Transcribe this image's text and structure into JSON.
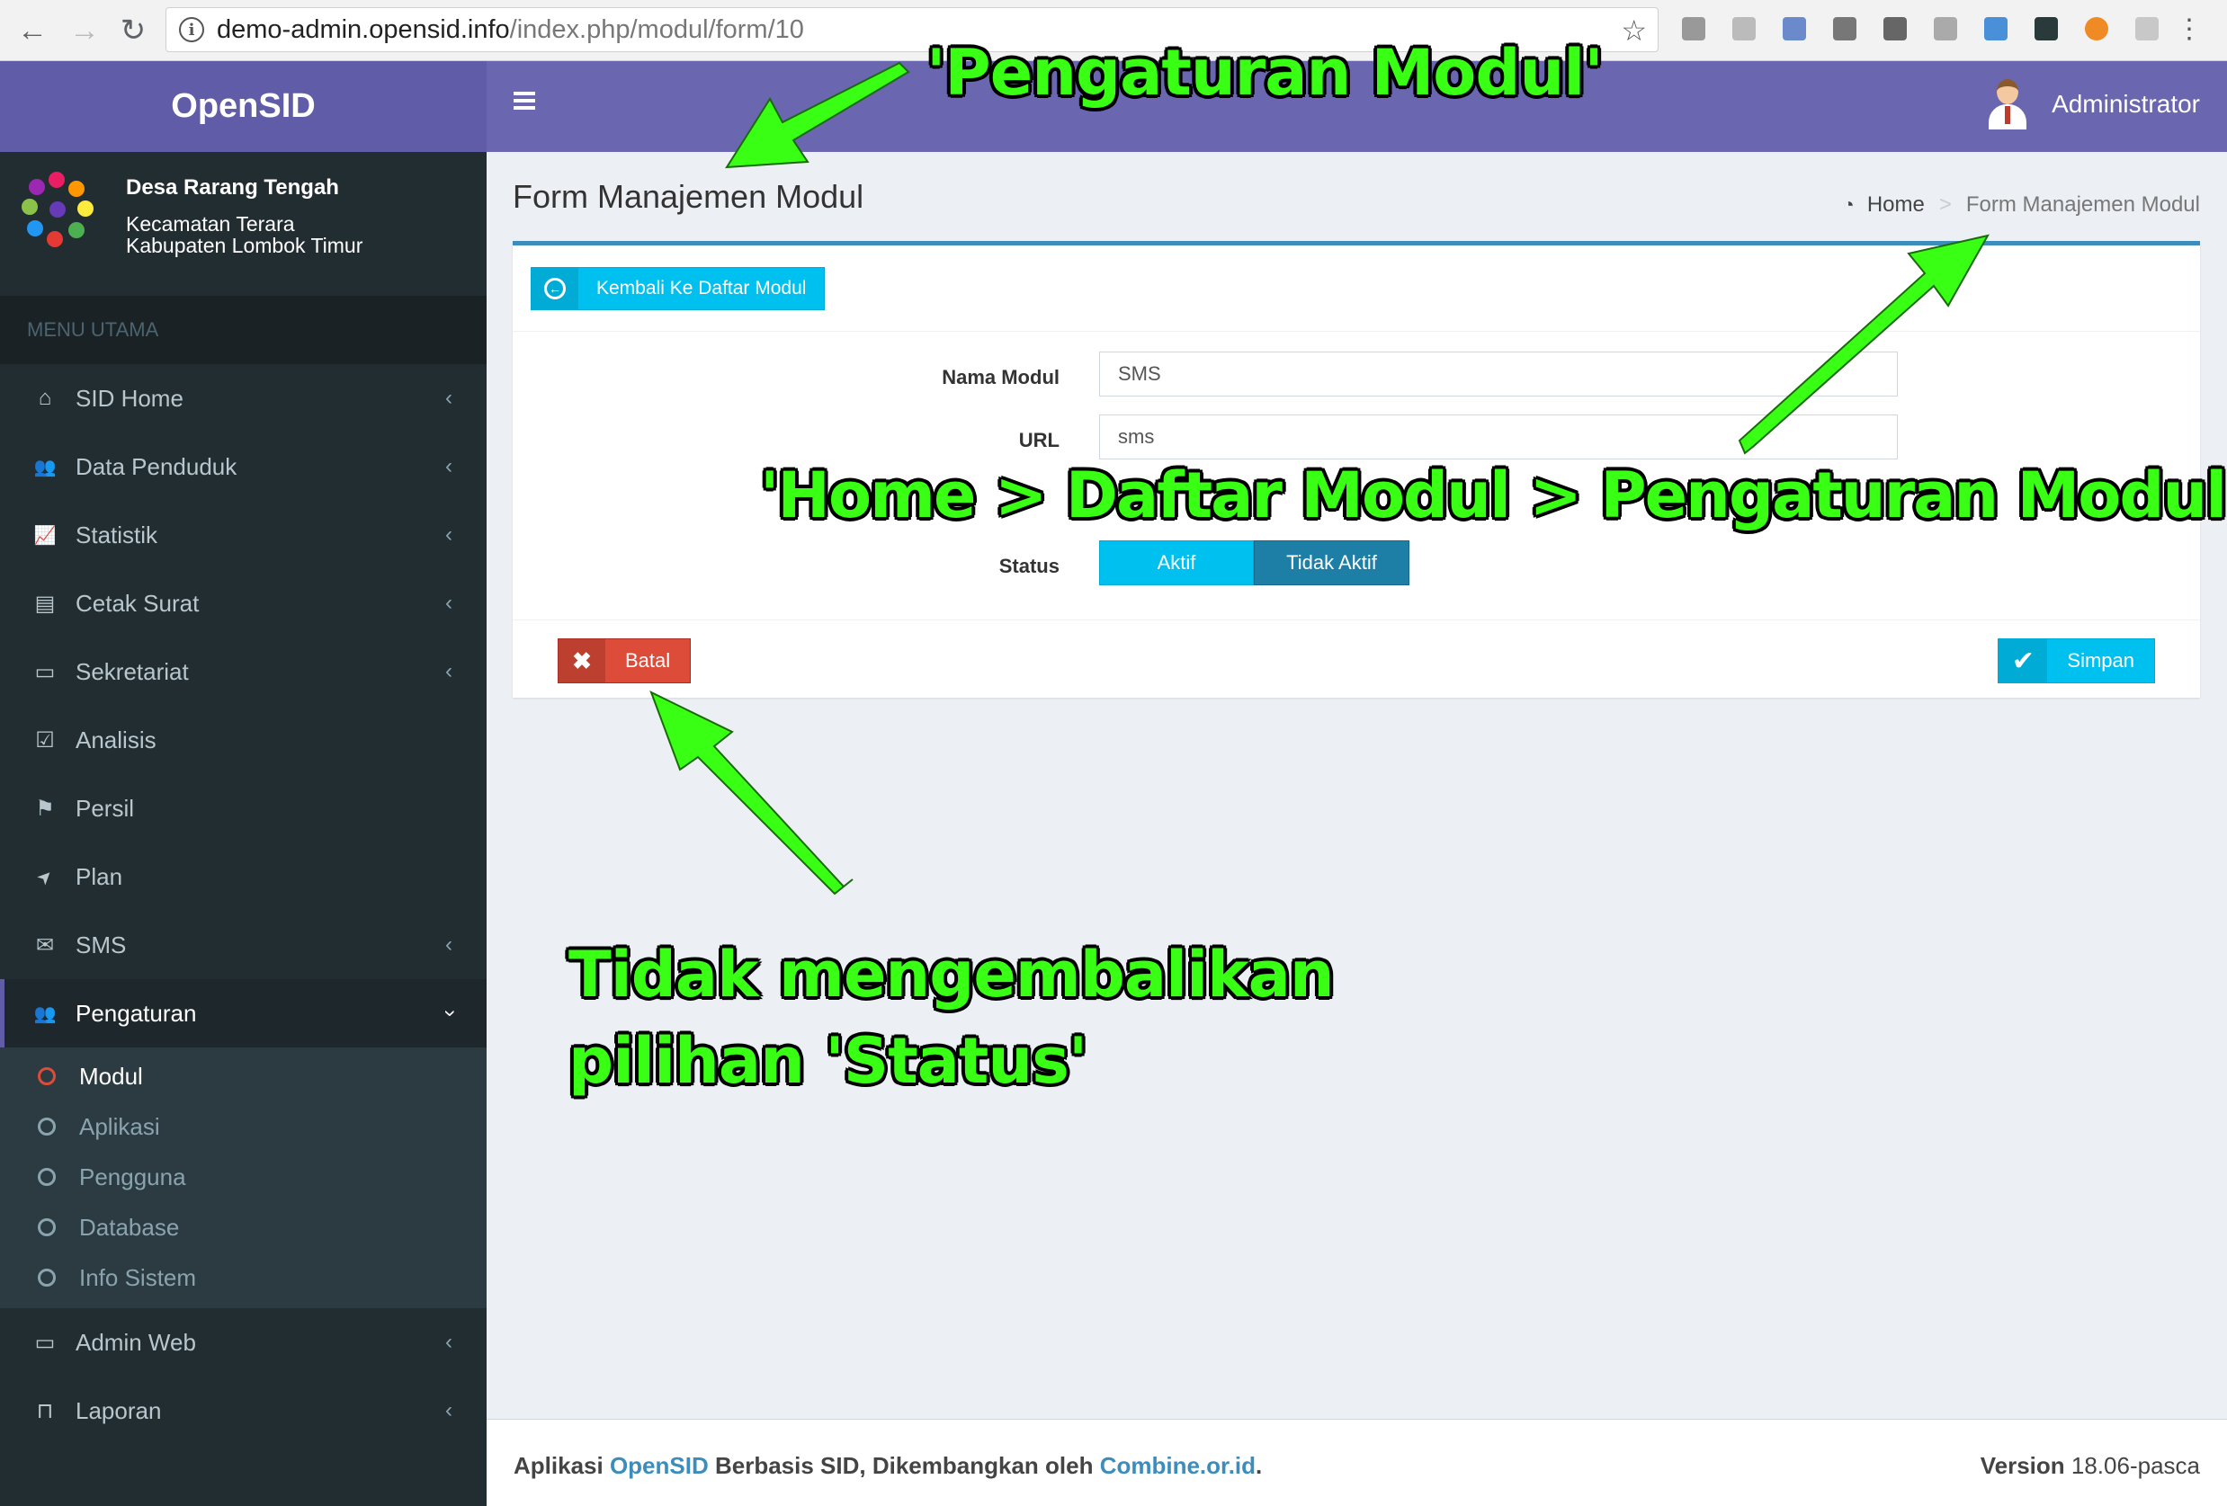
{
  "browser": {
    "url_host": "demo-admin.opensid.info",
    "url_path": "/index.php/modul/form/10",
    "icons": [
      "back-icon",
      "forward-icon",
      "reload-icon",
      "info-icon",
      "star-icon",
      "menu-dots-icon"
    ]
  },
  "app": {
    "logo_text": "OpenSID",
    "user_name": "Administrator"
  },
  "village": {
    "name": "Desa Rarang Tengah",
    "district": "Kecamatan Terara",
    "regency": "Kabupaten Lombok Timur"
  },
  "sidebar": {
    "header": "MENU UTAMA",
    "items": [
      {
        "label": "SID Home",
        "icon": "home-icon",
        "glyph": "⌂",
        "has_children": true
      },
      {
        "label": "Data Penduduk",
        "icon": "users-icon",
        "glyph": "👥",
        "has_children": true
      },
      {
        "label": "Statistik",
        "icon": "line-chart-icon",
        "glyph": "📈",
        "has_children": true
      },
      {
        "label": "Cetak Surat",
        "icon": "book-icon",
        "glyph": "▤",
        "has_children": true
      },
      {
        "label": "Sekretariat",
        "icon": "archive-icon",
        "glyph": "▭",
        "has_children": true
      },
      {
        "label": "Analisis",
        "icon": "check-square-icon",
        "glyph": "☑",
        "has_children": false
      },
      {
        "label": "Persil",
        "icon": "signpost-icon",
        "glyph": "⚑",
        "has_children": false
      },
      {
        "label": "Plan",
        "icon": "location-arrow-icon",
        "glyph": "➤",
        "has_children": false
      },
      {
        "label": "SMS",
        "icon": "envelope-icon",
        "glyph": "✉",
        "has_children": true
      },
      {
        "label": "Pengaturan",
        "icon": "users-icon",
        "glyph": "👥",
        "has_children": true,
        "expanded": true
      },
      {
        "label": "Admin Web",
        "icon": "desktop-icon",
        "glyph": "▭",
        "has_children": true
      },
      {
        "label": "Laporan",
        "icon": "inbox-icon",
        "glyph": "⊓",
        "has_children": true
      }
    ],
    "submenu": [
      {
        "label": "Modul",
        "active": true
      },
      {
        "label": "Aplikasi"
      },
      {
        "label": "Pengguna"
      },
      {
        "label": "Database"
      },
      {
        "label": "Info Sistem"
      }
    ]
  },
  "page": {
    "title": "Form Manajemen Modul",
    "breadcrumb_home": "Home",
    "breadcrumb_separator": ">",
    "breadcrumb_current": "Form Manajemen Modul"
  },
  "form": {
    "back_button": "Kembali Ke Daftar Modul",
    "fields": [
      {
        "label": "Nama Modul",
        "value": "SMS"
      },
      {
        "label": "URL",
        "value": "sms"
      }
    ],
    "status_label": "Status",
    "status_options": [
      "Aktif",
      "Tidak Aktif"
    ],
    "cancel_button": "Batal",
    "save_button": "Simpan"
  },
  "footer": {
    "text_prefix": "Aplikasi",
    "app_link": "OpenSID",
    "text_middle": "Berbasis SID, Dikembangkan oleh",
    "org_link": "Combine.or.id",
    "text_end": ".",
    "version_label": "Version",
    "version_value": "18.06-pasca"
  },
  "annotations": {
    "top": "'Pengaturan Modul'",
    "middle": "'Home > Daftar Modul > Pengaturan Modul'",
    "bottom_line1": "Tidak mengembalikan",
    "bottom_line2": "pilihan 'Status'",
    "color": "#39ff14"
  },
  "colors": {
    "header": "#605ca8",
    "sidebar": "#222d32",
    "accent": "#3c8dbc",
    "info": "#00c0ef",
    "danger": "#dd4b39"
  }
}
